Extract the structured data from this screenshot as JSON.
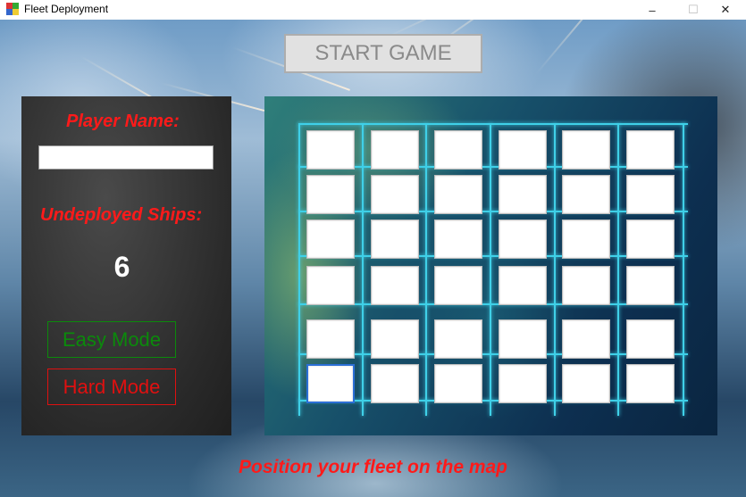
{
  "window": {
    "title": "Fleet Deployment",
    "minimize": "–",
    "maximize": "☐",
    "close": "✕"
  },
  "top": {
    "start_button": "START GAME"
  },
  "left_panel": {
    "player_name_label": "Player Name:",
    "player_name_value": "",
    "undeployed_label": "Undeployed Ships:",
    "undeployed_count": "6",
    "easy_mode": "Easy Mode",
    "hard_mode": "Hard Mode"
  },
  "board": {
    "rows": 6,
    "cols": 6,
    "selected_cell": {
      "row": 6,
      "col": 1
    }
  },
  "status": {
    "message": "Position your fleet on the map"
  },
  "colors": {
    "label_red": "#ff1a1a",
    "easy_green": "#0b8a0b",
    "grid_cyan": "#3fd0e8"
  }
}
